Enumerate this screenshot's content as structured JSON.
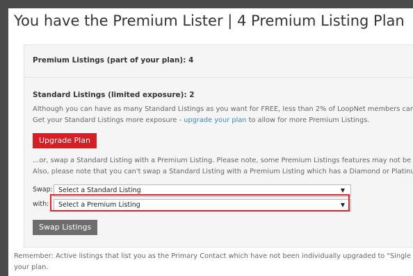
{
  "title": "You have the Premium Lister | 4 Premium Listing Plan",
  "premium_section": {
    "heading": "Premium Listings (part of your plan): 4"
  },
  "standard_section": {
    "heading": "Standard Listings (limited exposure): 2",
    "desc_line1": "Although you can have as many Standard Listings as you want for FREE, less than 2% of LoopNet members can con",
    "desc_line2_pre": "Get your Standard Listings more exposure - ",
    "desc_line2_link": "upgrade your plan",
    "desc_line2_post": " to allow for more Premium Listings.",
    "upgrade_button": "Upgrade Plan",
    "swap_line1": "...or, swap a Standard Listing with a Premium Listing. Please note, some Premium Listings features may not be avai",
    "swap_line2": "Also, please note that you can't swap a Standard Listing with a Premium Listing which has a Diamond or Platinum",
    "swap_label": "Swap:",
    "swap_select": "Select a Standard Listing",
    "with_label": "with:",
    "with_select": "Select a Premium Listing",
    "swap_button": "Swap Listings"
  },
  "footer": {
    "line1": "Remember: Active listings that list you as the Primary Contact which have not been individually upgraded to \"Single Pr",
    "line2": "your plan."
  },
  "icons": {
    "dropdown": "chevron-down-icon"
  },
  "colors": {
    "accent_red": "#d51f26",
    "link_blue": "#3a8bc6",
    "button_gray": "#6d6d6d",
    "highlight": "#e0232a"
  }
}
